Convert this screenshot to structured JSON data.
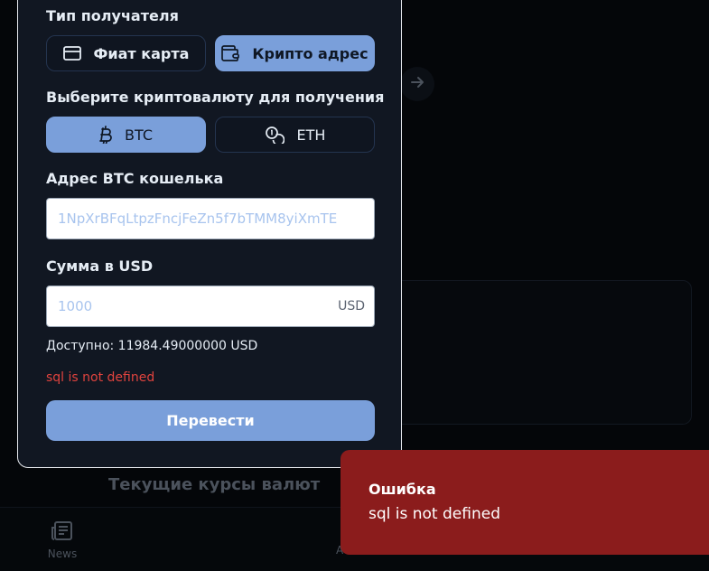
{
  "background": {
    "rates_title": "Текущие курсы валют",
    "nav": {
      "news_label": "News",
      "other_label": "A"
    }
  },
  "form": {
    "recipient_type_label": "Тип получателя",
    "recipient_options": [
      {
        "label": "Фиат карта",
        "icon": "credit-card-icon",
        "selected": false
      },
      {
        "label": "Крипто адрес",
        "icon": "wallet-icon",
        "selected": true
      }
    ],
    "crypto_label": "Выберите криптовалюту для получения",
    "crypto_options": [
      {
        "label": "BTC",
        "icon": "bitcoin-icon",
        "selected": true
      },
      {
        "label": "ETH",
        "icon": "coins-icon",
        "selected": false
      }
    ],
    "address_label": "Адрес BTC кошелька",
    "address_placeholder": "1NpXrBFqLtpzFncjFeZn5f7bTMM8yiXmTE",
    "address_value": "",
    "amount_label": "Сумма в USD",
    "amount_placeholder": "1000",
    "amount_value": "",
    "amount_suffix": "USD",
    "available_text": "Доступно: 11984.49000000 USD",
    "error_text": "sql is not defined",
    "submit_label": "Перевести"
  },
  "toast": {
    "title": "Ошибка",
    "message": "sql is not defined"
  },
  "colors": {
    "accent": "#7a9fda",
    "modal_bg": "#111722",
    "error": "#e0433e",
    "toast_bg": "#8b1c1c"
  }
}
